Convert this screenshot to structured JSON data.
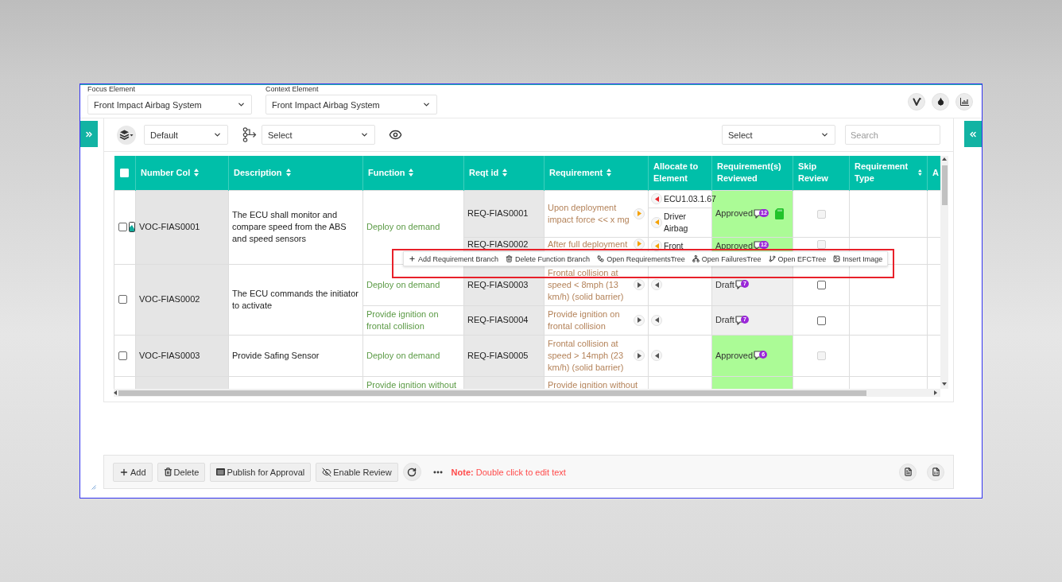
{
  "header": {
    "fields": [
      {
        "label": "Focus Element",
        "value": "Front Impact Airbag System"
      },
      {
        "label": "Context Element",
        "value": "Front Impact Airbag System"
      }
    ]
  },
  "toolbar": {
    "view": {
      "value": "Default"
    },
    "layout": {
      "value": "Select"
    },
    "filter": {
      "value": "Select"
    },
    "search": {
      "placeholder": "Search"
    }
  },
  "table": {
    "select_all": {
      "checked": false
    },
    "columns": [
      {
        "title": "Number Col",
        "sortable": true
      },
      {
        "title": "Description",
        "sortable": true
      },
      {
        "title": "Function",
        "sortable": true
      },
      {
        "title": "Reqt id",
        "sortable": true
      },
      {
        "title": "Requirement",
        "sortable": true
      },
      {
        "title": "Allocate to Element",
        "sortable": false
      },
      {
        "title": "Requirement(s) Reviewed",
        "sortable": false
      },
      {
        "title": "Skip Review",
        "sortable": false
      },
      {
        "title": "Requirement Type",
        "sortable": true
      },
      {
        "title": "A"
      }
    ],
    "rows": [
      {
        "checked": false,
        "has_image": true,
        "number": "VOC-FIAS0001",
        "description": "The ECU shall monitor and compare speed from the ABS and speed sensors",
        "functions": [
          {
            "name": "Deploy on demand",
            "requirements": [
              {
                "id": "REQ-FIAS0001",
                "text": "Upon deployment impact force << x mg",
                "link": {
                  "color": "#f5a100"
                },
                "allocations": [
                  {
                    "name": "ECU1.03.1.67",
                    "color": "#e8232b"
                  },
                  {
                    "name": "Driver Airbag",
                    "color": "#f5a100"
                  }
                ],
                "status": "Approved",
                "approved": true,
                "comments": "12",
                "attachment": true,
                "skip_review": {
                  "checked": false,
                  "disabled": true
                },
                "menu_open": false
              },
              {
                "id": "REQ-FIAS0002",
                "text": "After full deployment",
                "link": {
                  "color": "#f5a100"
                },
                "allocations": [
                  {
                    "name": "Front",
                    "color": "#f5a100"
                  }
                ],
                "status": "Approved",
                "approved": true,
                "comments": "12",
                "attachment": false,
                "skip_review": {
                  "checked": false,
                  "disabled": true
                },
                "menu_open": true
              }
            ]
          }
        ]
      },
      {
        "checked": false,
        "has_image": false,
        "number": "VOC-FIAS0002",
        "description": "The ECU commands the initiator to activate",
        "functions": [
          {
            "name": "Deploy on demand",
            "requirements": [
              {
                "id": "REQ-FIAS0003",
                "text": "Frontal collision at speed < 8mph (13 km/h) (solid barrier)",
                "link": {
                  "color": "#555555"
                },
                "allocations": [
                  {
                    "color": "#555555"
                  }
                ],
                "status": "Draft",
                "approved": false,
                "comments": "7",
                "attachment": false,
                "skip_review": {
                  "checked": false,
                  "disabled": false
                },
                "menu_open": false
              }
            ]
          },
          {
            "name": "Provide ignition on frontal collision",
            "requirements": [
              {
                "id": "REQ-FIAS0004",
                "text": "Provide ignition on frontal collision",
                "link": {
                  "color": "#555555"
                },
                "allocations": [
                  {
                    "color": "#555555"
                  }
                ],
                "status": "Draft",
                "approved": false,
                "comments": "7",
                "attachment": false,
                "skip_review": {
                  "checked": false,
                  "disabled": false
                },
                "menu_open": false
              }
            ]
          }
        ]
      },
      {
        "checked": false,
        "has_image": false,
        "number": "VOC-FIAS0003",
        "description": "Provide Safing Sensor",
        "functions": [
          {
            "name": "Deploy on demand",
            "requirements": [
              {
                "id": "REQ-FIAS0005",
                "text": "Frontal collision at speed > 14mph (23 km/h) (solid barrier)",
                "link": {
                  "color": "#555555"
                },
                "allocations": [
                  {
                    "color": "#555555"
                  }
                ],
                "status": "Approved",
                "approved": true,
                "comments": "6",
                "attachment": false,
                "skip_review": {
                  "checked": false,
                  "disabled": true
                },
                "menu_open": false
              }
            ]
          }
        ]
      },
      {
        "functions": [
          {
            "name": "Provide ignition without",
            "requirements": [
              {
                "text": "Provide ignition without",
                "approved": true
              }
            ]
          }
        ]
      }
    ]
  },
  "context_menu": {
    "highlighted": true,
    "items": [
      {
        "kind": "add",
        "label": "Add Requirement Branch"
      },
      {
        "kind": "delete",
        "label": "Delete Function Branch"
      },
      {
        "kind": "diagram",
        "label": "Open RequirementsTree"
      },
      {
        "kind": "sitemap",
        "label": "Open FailuresTree"
      },
      {
        "kind": "branch",
        "label": "Open EFCTree"
      },
      {
        "kind": "image",
        "label": "Insert Image"
      }
    ]
  },
  "footer": {
    "buttons": [
      {
        "kind": "add",
        "label": "Add"
      },
      {
        "kind": "delete",
        "label": "Delete"
      },
      {
        "kind": "publish",
        "label": "Publish for Approval"
      },
      {
        "kind": "review",
        "label": "Enable Review"
      }
    ],
    "note": "**Note:** Double click to edit text"
  }
}
